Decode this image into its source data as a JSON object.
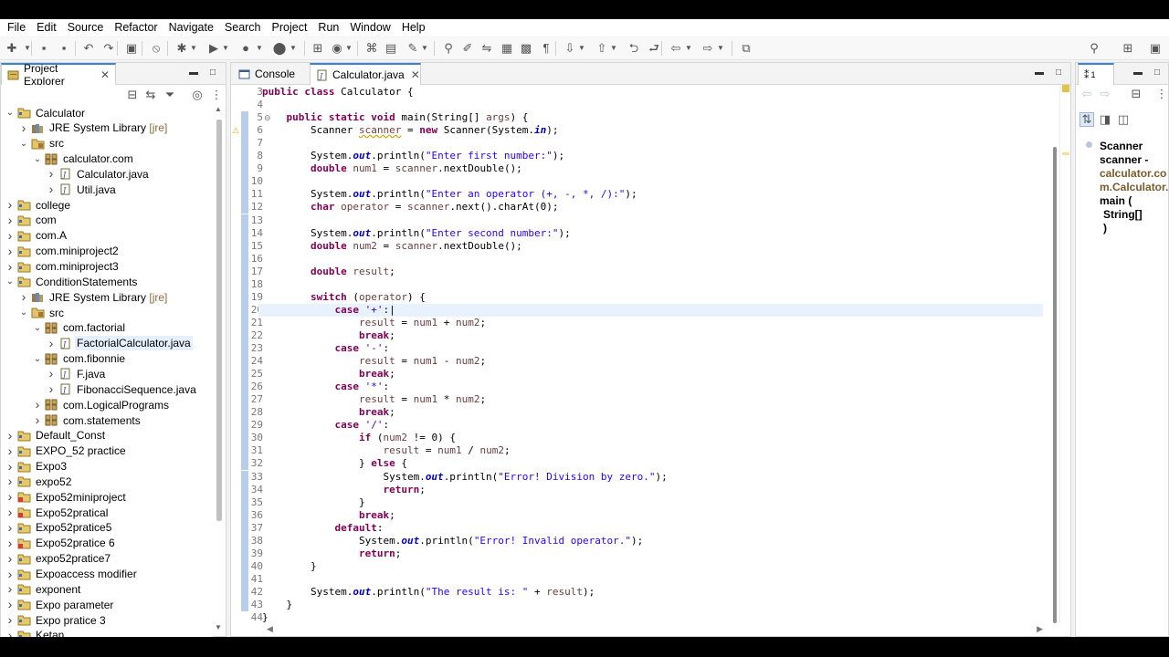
{
  "menu": [
    "File",
    "Edit",
    "Source",
    "Refactor",
    "Navigate",
    "Search",
    "Project",
    "Run",
    "Window",
    "Help"
  ],
  "project_explorer": {
    "tab_label": "Project Explorer",
    "tree": [
      {
        "label": "Calculator",
        "depth": 0,
        "expanded": true,
        "icon": "project-icon"
      },
      {
        "label": "JRE System Library",
        "decoration": "[jre]",
        "depth": 1,
        "expanded": false,
        "icon": "library-icon"
      },
      {
        "label": "src",
        "depth": 1,
        "expanded": true,
        "icon": "source-folder-icon"
      },
      {
        "label": "calculator.com",
        "depth": 2,
        "expanded": true,
        "icon": "package-icon"
      },
      {
        "label": "Calculator.java",
        "depth": 3,
        "expanded": false,
        "icon": "java-file-icon"
      },
      {
        "label": "Util.java",
        "depth": 3,
        "expanded": false,
        "icon": "java-file-icon"
      },
      {
        "label": "college",
        "depth": 0,
        "expanded": false,
        "icon": "project-icon"
      },
      {
        "label": "com",
        "depth": 0,
        "expanded": false,
        "icon": "project-icon"
      },
      {
        "label": "com.A",
        "depth": 0,
        "expanded": false,
        "icon": "project-icon"
      },
      {
        "label": "com.miniproject2",
        "depth": 0,
        "expanded": false,
        "icon": "project-icon"
      },
      {
        "label": "com.miniproject3",
        "depth": 0,
        "expanded": false,
        "icon": "project-icon"
      },
      {
        "label": "ConditionStatements",
        "depth": 0,
        "expanded": true,
        "icon": "project-icon"
      },
      {
        "label": "JRE System Library",
        "decoration": "[jre]",
        "depth": 1,
        "expanded": false,
        "icon": "library-icon"
      },
      {
        "label": "src",
        "depth": 1,
        "expanded": true,
        "icon": "source-folder-icon"
      },
      {
        "label": "com.factorial",
        "depth": 2,
        "expanded": true,
        "icon": "package-icon"
      },
      {
        "label": "FactorialCalculator.java",
        "depth": 3,
        "expanded": false,
        "icon": "java-file-icon",
        "selected": true
      },
      {
        "label": "com.fibonnie",
        "depth": 2,
        "expanded": true,
        "icon": "package-icon"
      },
      {
        "label": "F.java",
        "depth": 3,
        "expanded": false,
        "icon": "java-file-icon"
      },
      {
        "label": "FibonacciSequence.java",
        "depth": 3,
        "expanded": false,
        "icon": "java-file-icon"
      },
      {
        "label": "com.LogicalPrograms",
        "depth": 2,
        "expanded": false,
        "icon": "package-icon"
      },
      {
        "label": "com.statements",
        "depth": 2,
        "expanded": false,
        "icon": "package-icon"
      },
      {
        "label": "Default_Const",
        "depth": 0,
        "expanded": false,
        "icon": "project-icon"
      },
      {
        "label": "EXPO_52 practice",
        "depth": 0,
        "expanded": false,
        "icon": "project-icon"
      },
      {
        "label": "Expo3",
        "depth": 0,
        "expanded": false,
        "icon": "project-icon"
      },
      {
        "label": "expo52",
        "depth": 0,
        "expanded": false,
        "icon": "project-icon"
      },
      {
        "label": "Expo52miniproject",
        "depth": 0,
        "expanded": false,
        "icon": "project-error-icon"
      },
      {
        "label": "Expo52pratical",
        "depth": 0,
        "expanded": false,
        "icon": "project-error-icon"
      },
      {
        "label": "Expo52pratice5",
        "depth": 0,
        "expanded": false,
        "icon": "project-icon"
      },
      {
        "label": "Expo52pratice 6",
        "depth": 0,
        "expanded": false,
        "icon": "project-error-icon"
      },
      {
        "label": "expo52pratice7",
        "depth": 0,
        "expanded": false,
        "icon": "project-icon"
      },
      {
        "label": "Expoaccess modifier",
        "depth": 0,
        "expanded": false,
        "icon": "project-icon"
      },
      {
        "label": "exponent",
        "depth": 0,
        "expanded": false,
        "icon": "project-icon"
      },
      {
        "label": "Expo parameter",
        "depth": 0,
        "expanded": false,
        "icon": "project-icon"
      },
      {
        "label": "Expo pratice 3",
        "depth": 0,
        "expanded": false,
        "icon": "project-icon"
      },
      {
        "label": "Ketan",
        "depth": 0,
        "expanded": false,
        "icon": "project-icon"
      }
    ]
  },
  "editor": {
    "tabs": [
      {
        "label": "Console",
        "icon": "console-icon",
        "active": false
      },
      {
        "label": "Calculator.java",
        "icon": "java-file-icon",
        "active": true
      }
    ],
    "current_line": 20,
    "changed_lines_from": 5,
    "changed_lines_to": 43,
    "lines": [
      {
        "n": "3",
        "html": "<span class=\"kw\">public class</span> Calculator {"
      },
      {
        "n": "4",
        "html": ""
      },
      {
        "n": "5",
        "html": "    <span class=\"kw\">public static void</span> main(String[] <span class=\"var\">args</span>) {"
      },
      {
        "n": "6",
        "html": "        Scanner <span class=\"var warn\">scanner</span> = <span class=\"kw\">new</span> Scanner(System.<span class=\"fld\">in</span>);"
      },
      {
        "n": "7",
        "html": ""
      },
      {
        "n": "8",
        "html": "        System.<span class=\"fld\">out</span>.println(<span class=\"str\">\"Enter first number:\"</span>);"
      },
      {
        "n": "9",
        "html": "        <span class=\"kw\">double</span> <span class=\"var\">num1</span> = <span class=\"var\">scanner</span>.nextDouble();"
      },
      {
        "n": "10",
        "html": ""
      },
      {
        "n": "11",
        "html": "        System.<span class=\"fld\">out</span>.println(<span class=\"str\">\"Enter an operator (+, -, *, /):\"</span>);"
      },
      {
        "n": "12",
        "html": "        <span class=\"kw\">char</span> <span class=\"var\">operator</span> = <span class=\"var\">scanner</span>.next().charAt(0);"
      },
      {
        "n": "13",
        "html": ""
      },
      {
        "n": "14",
        "html": "        System.<span class=\"fld\">out</span>.println(<span class=\"str\">\"Enter second number:\"</span>);"
      },
      {
        "n": "15",
        "html": "        <span class=\"kw\">double</span> <span class=\"var\">num2</span> = <span class=\"var\">scanner</span>.nextDouble();"
      },
      {
        "n": "16",
        "html": ""
      },
      {
        "n": "17",
        "html": "        <span class=\"kw\">double</span> <span class=\"var\">result</span>;"
      },
      {
        "n": "18",
        "html": ""
      },
      {
        "n": "19",
        "html": "        <span class=\"kw\">switch</span> (<span class=\"var\">operator</span>) {"
      },
      {
        "n": "20",
        "html": "            <span class=\"kw\">case</span> <span class=\"str\">'+'</span>:|"
      },
      {
        "n": "21",
        "html": "                <span class=\"var\">result</span> = <span class=\"var\">num1</span> + <span class=\"var\">num2</span>;"
      },
      {
        "n": "22",
        "html": "                <span class=\"kw\">break</span>;"
      },
      {
        "n": "23",
        "html": "            <span class=\"kw\">case</span> <span class=\"str\">'-'</span>:"
      },
      {
        "n": "24",
        "html": "                <span class=\"var\">result</span> = <span class=\"var\">num1</span> - <span class=\"var\">num2</span>;"
      },
      {
        "n": "25",
        "html": "                <span class=\"kw\">break</span>;"
      },
      {
        "n": "26",
        "html": "            <span class=\"kw\">case</span> <span class=\"str\">'*'</span>:"
      },
      {
        "n": "27",
        "html": "                <span class=\"var\">result</span> = <span class=\"var\">num1</span> * <span class=\"var\">num2</span>;"
      },
      {
        "n": "28",
        "html": "                <span class=\"kw\">break</span>;"
      },
      {
        "n": "29",
        "html": "            <span class=\"kw\">case</span> <span class=\"str\">'/'</span>:"
      },
      {
        "n": "30",
        "html": "                <span class=\"kw\">if</span> (<span class=\"var\">num2</span> != 0) {"
      },
      {
        "n": "31",
        "html": "                    <span class=\"var\">result</span> = <span class=\"var\">num1</span> / <span class=\"var\">num2</span>;"
      },
      {
        "n": "32",
        "html": "                } <span class=\"kw\">else</span> {"
      },
      {
        "n": "33",
        "html": "                    System.<span class=\"fld\">out</span>.println(<span class=\"str\">\"Error! Division by zero.\"</span>);"
      },
      {
        "n": "34",
        "html": "                    <span class=\"kw\">return</span>;"
      },
      {
        "n": "35",
        "html": "                }"
      },
      {
        "n": "36",
        "html": "                <span class=\"kw\">break</span>;"
      },
      {
        "n": "37",
        "html": "            <span class=\"kw\">default</span>:"
      },
      {
        "n": "38",
        "html": "                System.<span class=\"fld\">out</span>.println(<span class=\"str\">\"Error! Invalid operator.\"</span>);"
      },
      {
        "n": "39",
        "html": "                <span class=\"kw\">return</span>;"
      },
      {
        "n": "40",
        "html": "        }"
      },
      {
        "n": "41",
        "html": ""
      },
      {
        "n": "42",
        "html": "        System.<span class=\"fld\">out</span>.println(<span class=\"str\">\"The result is: \"</span> + <span class=\"var\">result</span>);"
      },
      {
        "n": "43",
        "html": "    }"
      },
      {
        "n": "44",
        "html": "}"
      }
    ]
  },
  "outline": {
    "header_label": "1",
    "element": "Scanner scanner - calculator.com.Calculator.main ( String[] )",
    "lines": [
      "Scanner",
      "scanner -",
      "calculator.co",
      "m.Calculator.",
      "main (",
      "String[]",
      ")"
    ]
  },
  "colors": {
    "keyword": "#7f0055",
    "string": "#2a00ff",
    "field": "#0000c0",
    "local_variable": "#6a3e3e",
    "line_number": "#787878",
    "current_line": "#e8f2fe",
    "change_bar": "#b8cdea",
    "active_tab_accent": "#3c82d6"
  }
}
